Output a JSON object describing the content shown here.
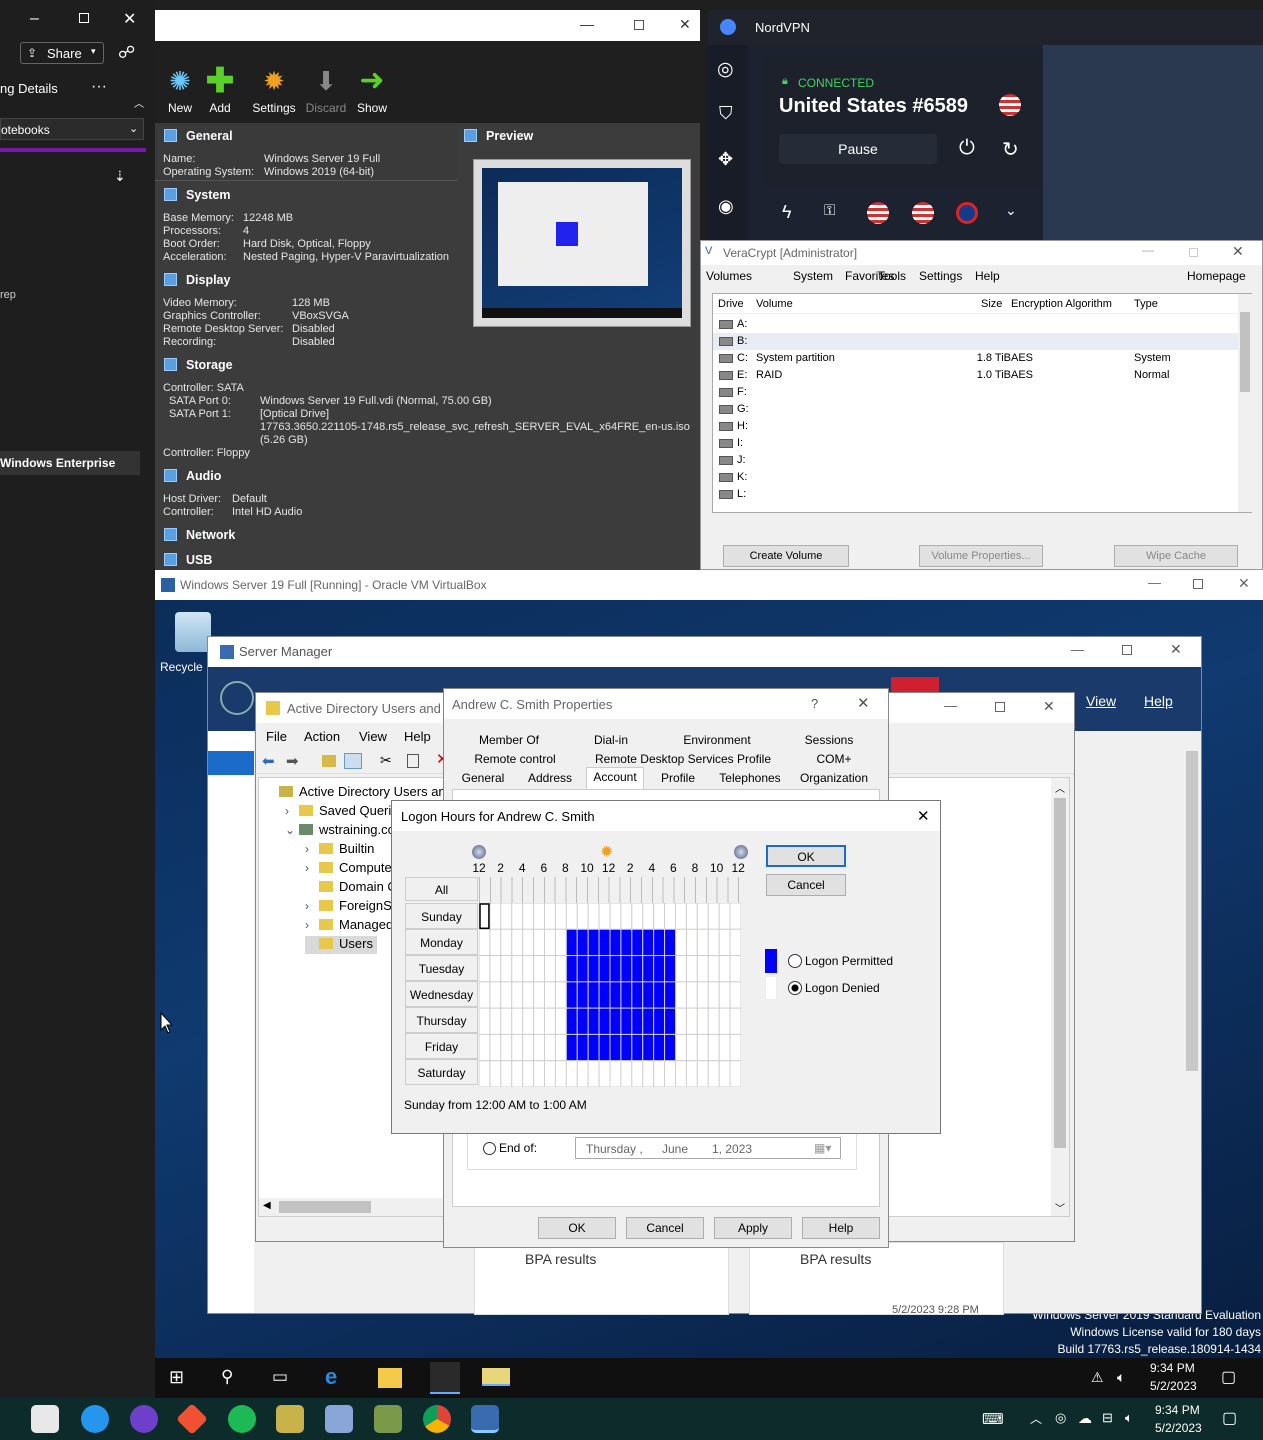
{
  "onenote": {
    "share": "Share",
    "details": "ng Details",
    "notebooks": "otebooks",
    "rep": "rep",
    "windows_enterprise": "Windows Enterprise"
  },
  "vbox_manager": {
    "toolbar": [
      {
        "label": "New",
        "icon": "new-icon"
      },
      {
        "label": "Add",
        "icon": "add-icon"
      },
      {
        "label": "Settings",
        "icon": "settings-icon"
      },
      {
        "label": "Discard",
        "icon": "discard-icon"
      },
      {
        "label": "Show",
        "icon": "show-icon"
      }
    ],
    "general": {
      "title": "General",
      "name_k": "Name:",
      "name_v": "Windows Server 19 Full",
      "os_k": "Operating System:",
      "os_v": "Windows 2019 (64-bit)"
    },
    "preview_title": "Preview",
    "system": {
      "title": "System",
      "rows": [
        [
          "Base Memory:",
          "12248 MB"
        ],
        [
          "Processors:",
          "4"
        ],
        [
          "Boot Order:",
          "Hard Disk, Optical, Floppy"
        ],
        [
          "Acceleration:",
          "Nested Paging, Hyper-V Paravirtualization"
        ]
      ]
    },
    "display": {
      "title": "Display",
      "rows": [
        [
          "Video Memory:",
          "128 MB"
        ],
        [
          "Graphics Controller:",
          "VBoxSVGA"
        ],
        [
          "Remote Desktop Server:",
          "Disabled"
        ],
        [
          "Recording:",
          "Disabled"
        ]
      ]
    },
    "storage": {
      "title": "Storage",
      "controller_sata": "Controller: SATA",
      "port0_k": "SATA Port 0:",
      "port0_v": "Windows Server 19 Full.vdi (Normal, 75.00 GB)",
      "port1_k": "SATA Port 1:",
      "port1_v1": "[Optical Drive]",
      "port1_v2": "17763.3650.221105-1748.rs5_release_svc_refresh_SERVER_EVAL_x64FRE_en-us.iso",
      "port1_v3": "(5.26 GB)",
      "controller_floppy": "Controller: Floppy"
    },
    "audio": {
      "title": "Audio",
      "rows": [
        [
          "Host Driver:",
          "Default"
        ],
        [
          "Controller:",
          "Intel HD Audio"
        ]
      ]
    },
    "network_title": "Network",
    "usb_title": "USB"
  },
  "nordvpn": {
    "app": "NordVPN",
    "status": "CONNECTED",
    "server": "United States #6589",
    "pause": "Pause"
  },
  "veracrypt": {
    "title": "VeraCrypt [Administrator]",
    "menu": [
      "Volumes",
      "System",
      "Favorites",
      "Tools",
      "Settings",
      "Help"
    ],
    "homepage": "Homepage",
    "columns": [
      "Drive",
      "Volume",
      "Size",
      "Encryption Algorithm",
      "Type"
    ],
    "rows": [
      [
        "A:",
        "",
        "",
        "",
        ""
      ],
      [
        "B:",
        "",
        "",
        "",
        ""
      ],
      [
        "C:",
        "System partition",
        "1.8 TiB",
        "AES",
        "System"
      ],
      [
        "E:",
        "RAID",
        "1.0 TiB",
        "AES",
        "Normal"
      ],
      [
        "F:",
        "",
        "",
        "",
        ""
      ],
      [
        "G:",
        "",
        "",
        "",
        ""
      ],
      [
        "H:",
        "",
        "",
        "",
        ""
      ],
      [
        "I:",
        "",
        "",
        "",
        ""
      ],
      [
        "J:",
        "",
        "",
        "",
        ""
      ],
      [
        "K:",
        "",
        "",
        "",
        ""
      ],
      [
        "L:",
        "",
        "",
        "",
        ""
      ]
    ],
    "buttons": [
      "Create Volume",
      "Volume Properties...",
      "Wipe Cache"
    ]
  },
  "vm_window": {
    "title": "Windows Server 19 Full [Running] - Oracle VM VirtualBox",
    "recycle": "Recycle",
    "watermark": [
      "Windows Server 2019 Standard Evaluation",
      "Windows License valid for 180 days",
      "Build 17763.rs5_release.180914-1434"
    ],
    "clock_time": "9:34 PM",
    "clock_date": "5/2/2023"
  },
  "server_manager": {
    "title": "Server Manager",
    "menu": [
      "View",
      "Help"
    ],
    "bpa1": "BPA results",
    "bpa2": "BPA results",
    "timestamp": "5/2/2023 9:28 PM"
  },
  "aduc": {
    "title": "Active Directory Users and C",
    "menu": [
      "File",
      "Action",
      "View",
      "Help"
    ],
    "tree": [
      "Active Directory Users and C",
      "Saved Queries",
      "wstraining.com",
      "Builtin",
      "Computers",
      "Domain Co",
      "ForeignSecu",
      "Managed S",
      "Users"
    ]
  },
  "properties": {
    "title": "Andrew C. Smith Properties",
    "help_glyph": "?",
    "tabs_row1": [
      "Member Of",
      "Dial-in",
      "Environment",
      "Sessions"
    ],
    "tabs_row2": [
      "Remote control",
      "Remote Desktop Services Profile",
      "COM+"
    ],
    "tabs_row3": [
      "General",
      "Address",
      "Account",
      "Profile",
      "Telephones",
      "Organization"
    ],
    "end_of": "End of:",
    "date_day": "Thursday ,",
    "date_month": "June",
    "date_num": "1, 2023",
    "buttons": [
      "OK",
      "Cancel",
      "Apply",
      "Help"
    ]
  },
  "logon_hours": {
    "title": "Logon Hours for Andrew C. Smith",
    "hour_labels": [
      "12",
      "2",
      "4",
      "6",
      "8",
      "10",
      "12",
      "2",
      "4",
      "6",
      "8",
      "10",
      "12"
    ],
    "all": "All",
    "days": [
      "Sunday",
      "Monday",
      "Tuesday",
      "Wednesday",
      "Thursday",
      "Friday",
      "Saturday"
    ],
    "permitted": [
      [],
      [
        8,
        9,
        9.9,
        10,
        11,
        12,
        13,
        14,
        15,
        16,
        17
      ],
      [
        8,
        9,
        10,
        11,
        12,
        13,
        14,
        15,
        16,
        17
      ],
      [
        8,
        9,
        10,
        11,
        12,
        13,
        14,
        15,
        16,
        17
      ],
      [
        8,
        9,
        10,
        11,
        12,
        13,
        14,
        15,
        16,
        17
      ],
      [
        8,
        9,
        10,
        11,
        12,
        13,
        14,
        15,
        16,
        17
      ],
      []
    ],
    "ok": "OK",
    "cancel": "Cancel",
    "legend_permitted": "Logon Permitted",
    "legend_denied": "Logon Denied",
    "status": "Sunday from 12:00 AM to 1:00 AM",
    "colors": {
      "permitted": "#0000ff",
      "denied": "#ffffff"
    }
  },
  "host_taskbar": {
    "time": "9:34 PM",
    "date": "5/2/2023"
  }
}
